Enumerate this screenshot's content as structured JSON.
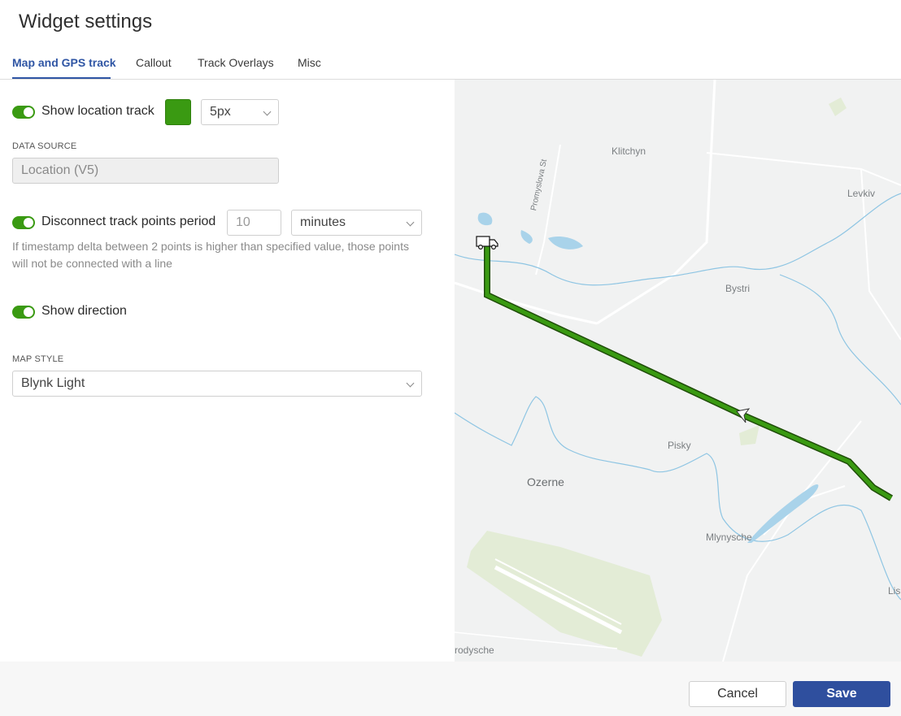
{
  "dialog": {
    "title": "Widget settings"
  },
  "tabs": [
    {
      "label": "Map and GPS track",
      "active": true
    },
    {
      "label": "Callout",
      "active": false
    },
    {
      "label": "Track Overlays",
      "active": false
    },
    {
      "label": "Misc",
      "active": false
    }
  ],
  "settings": {
    "show_location_track": {
      "label": "Show location track",
      "enabled": true,
      "color": "#3a9a12",
      "width_value": "5px"
    },
    "data_source": {
      "caption": "DATA SOURCE",
      "value": "Location (V5)"
    },
    "disconnect": {
      "label": "Disconnect track points period",
      "enabled": true,
      "period_value": "10",
      "unit_value": "minutes",
      "hint": "If timestamp delta between 2 points is higher than specified value, those points will not be connected with a line"
    },
    "show_direction": {
      "label": "Show direction",
      "enabled": true
    },
    "map_style": {
      "caption": "MAP STYLE",
      "value": "Blynk Light"
    }
  },
  "map": {
    "labels": {
      "klitchyn": "Klitchyn",
      "levkiv": "Levkiv",
      "promyslova": "Promyslova St",
      "bystri": "Bystri",
      "pisky": "Pisky",
      "ozerne": "Ozerne",
      "mlynysche": "Mlynysche",
      "rodysche": "rodysche",
      "lis": "Lis"
    },
    "track_color": "#3a9a12",
    "marker_icon": "truck-icon",
    "direction_icon": "arrow-icon"
  },
  "footer": {
    "cancel_label": "Cancel",
    "save_label": "Save"
  }
}
